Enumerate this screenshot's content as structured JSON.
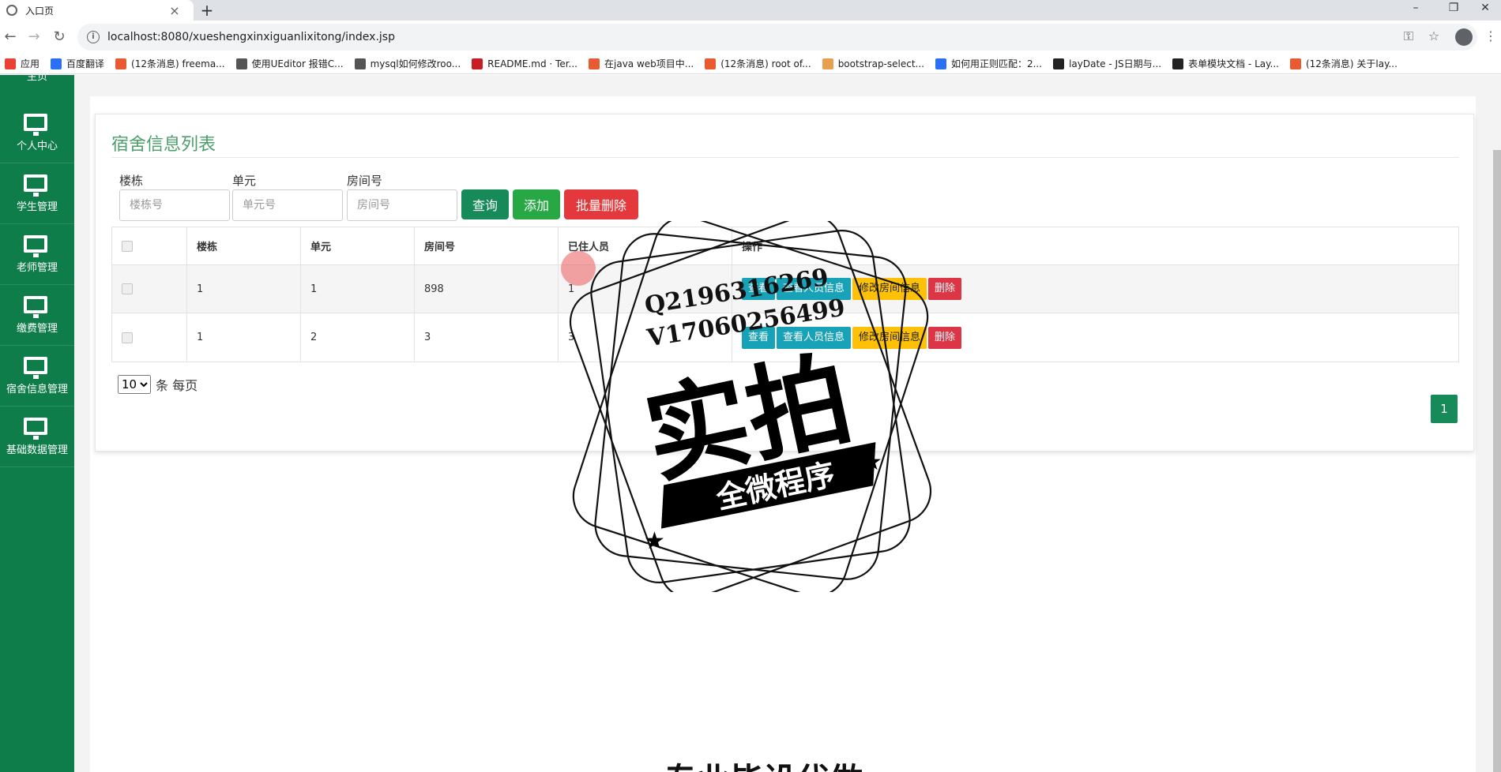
{
  "browser": {
    "tab_title": "入口页",
    "tab_close": "×",
    "new_tab": "+",
    "url": "localhost:8080/xueshengxinxiguanlixitong/index.jsp",
    "minimize": "–",
    "restore": "❐",
    "close": "✕",
    "bookmarks": [
      {
        "label": "应用",
        "color": "#e94235"
      },
      {
        "label": "百度翻译",
        "color": "#2b6ff3"
      },
      {
        "label": "(12条消息) freema...",
        "color": "#e85a32"
      },
      {
        "label": "使用UEditor 报错C...",
        "color": "#555555"
      },
      {
        "label": "mysql如何修改roo...",
        "color": "#555555"
      },
      {
        "label": "README.md · Ter...",
        "color": "#c71d23"
      },
      {
        "label": "在java web项目中...",
        "color": "#e85a32"
      },
      {
        "label": "(12条消息) root of...",
        "color": "#e85a32"
      },
      {
        "label": "bootstrap-select...",
        "color": "#e8a050"
      },
      {
        "label": "如何用正则匹配：2...",
        "color": "#2b6ff3"
      },
      {
        "label": "layDate - JS日期与...",
        "color": "#222222"
      },
      {
        "label": "表单模块文档 - Lay...",
        "color": "#222222"
      },
      {
        "label": "(12条消息) 关于lay...",
        "color": "#e85a32"
      }
    ]
  },
  "sidebar": {
    "top_label": "主页",
    "items": [
      {
        "label": "个人中心"
      },
      {
        "label": "学生管理"
      },
      {
        "label": "老师管理"
      },
      {
        "label": "缴费管理"
      },
      {
        "label": "宿舍信息管理"
      },
      {
        "label": "基础数据管理"
      }
    ]
  },
  "panel": {
    "title": "宿舍信息列表",
    "filters": {
      "building_label": "楼栋",
      "building_placeholder": "楼栋号",
      "unit_label": "单元",
      "unit_placeholder": "单元号",
      "room_label": "房间号",
      "room_placeholder": "房间号"
    },
    "buttons": {
      "query": "查询",
      "add": "添加",
      "batch_delete": "批量删除"
    },
    "table": {
      "headers": [
        "楼栋",
        "单元",
        "房间号",
        "已住人员",
        "操作"
      ],
      "rows": [
        {
          "building": "1",
          "unit": "1",
          "room": "898",
          "occupants": "1"
        },
        {
          "building": "1",
          "unit": "2",
          "room": "3",
          "occupants": "3"
        }
      ],
      "actions": {
        "view": "查看",
        "view_people": "查看人员信息",
        "edit_room": "修改房间信息",
        "delete": "删除"
      }
    },
    "pager": {
      "page_size": "10",
      "page_size_suffix": "条 每页",
      "current_page": "1"
    }
  },
  "watermark": {
    "line1": "Q2196316269",
    "line2": "V17060256499",
    "big": "实拍",
    "banner": "全微程序",
    "bottom": "专业毕设代做"
  }
}
